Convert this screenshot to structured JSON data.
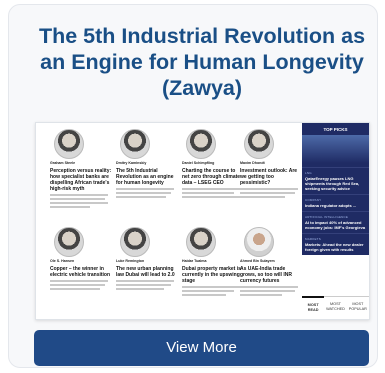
{
  "card": {
    "title": "The 5th Industrial Revolution as an Engine for Human Longevity (Zawya)",
    "button_label": "View More"
  },
  "embedded_page": {
    "articles": [
      {
        "author": "Graham Steele",
        "role": "",
        "headline": "Perception versus reality: how specialist banks are dispelling African trade's high-risk myth"
      },
      {
        "author": "Dmitry Kaminskiy",
        "role": "",
        "headline": "The 5th Industrial Revolution as an engine for human longevity"
      },
      {
        "author": "Daniel Schimpfling",
        "role": "",
        "headline": "Charting the course to net zero through climate data – LSEG CEO"
      },
      {
        "author": "Maxim Dhondt",
        "role": "",
        "headline": "Investment outlook: Are we getting too pessimistic?"
      },
      {
        "author": "Ole S. Hansen",
        "role": "",
        "headline": "Copper – the winner in electric vehicle transition"
      },
      {
        "author": "Luke Remington",
        "role": "",
        "headline": "The new urban planning law Dubai will lead to 2.0"
      },
      {
        "author": "Haidar Tuaima",
        "role": "",
        "headline": "Dubai property market is currently in the upswing stage"
      },
      {
        "author": "Ahmed Bin Sulayem",
        "role": "",
        "headline": "As UAE-India trade grows, so too will INR currency futures"
      }
    ],
    "sidebar": {
      "heading": "TOP PICKS",
      "items": [
        {
          "kicker": "LNG",
          "title": "QatarEnergy pauses LNG shipments through Red Sea, seeking security advice"
        },
        {
          "kicker": "COMPANY",
          "title": "Indiana regulator adopts ..."
        },
        {
          "kicker": "ARTIFICIAL INTELLIGENCE",
          "title": "AI to impact 40% of advanced economy jobs: IMF's Georgieva"
        },
        {
          "kicker": "MARKETS",
          "title": "Markets: Ahead the new dealer foreign given with results"
        }
      ],
      "tabs": [
        "MOST READ",
        "MOST WATCHED",
        "MOST POPULAR"
      ]
    }
  }
}
